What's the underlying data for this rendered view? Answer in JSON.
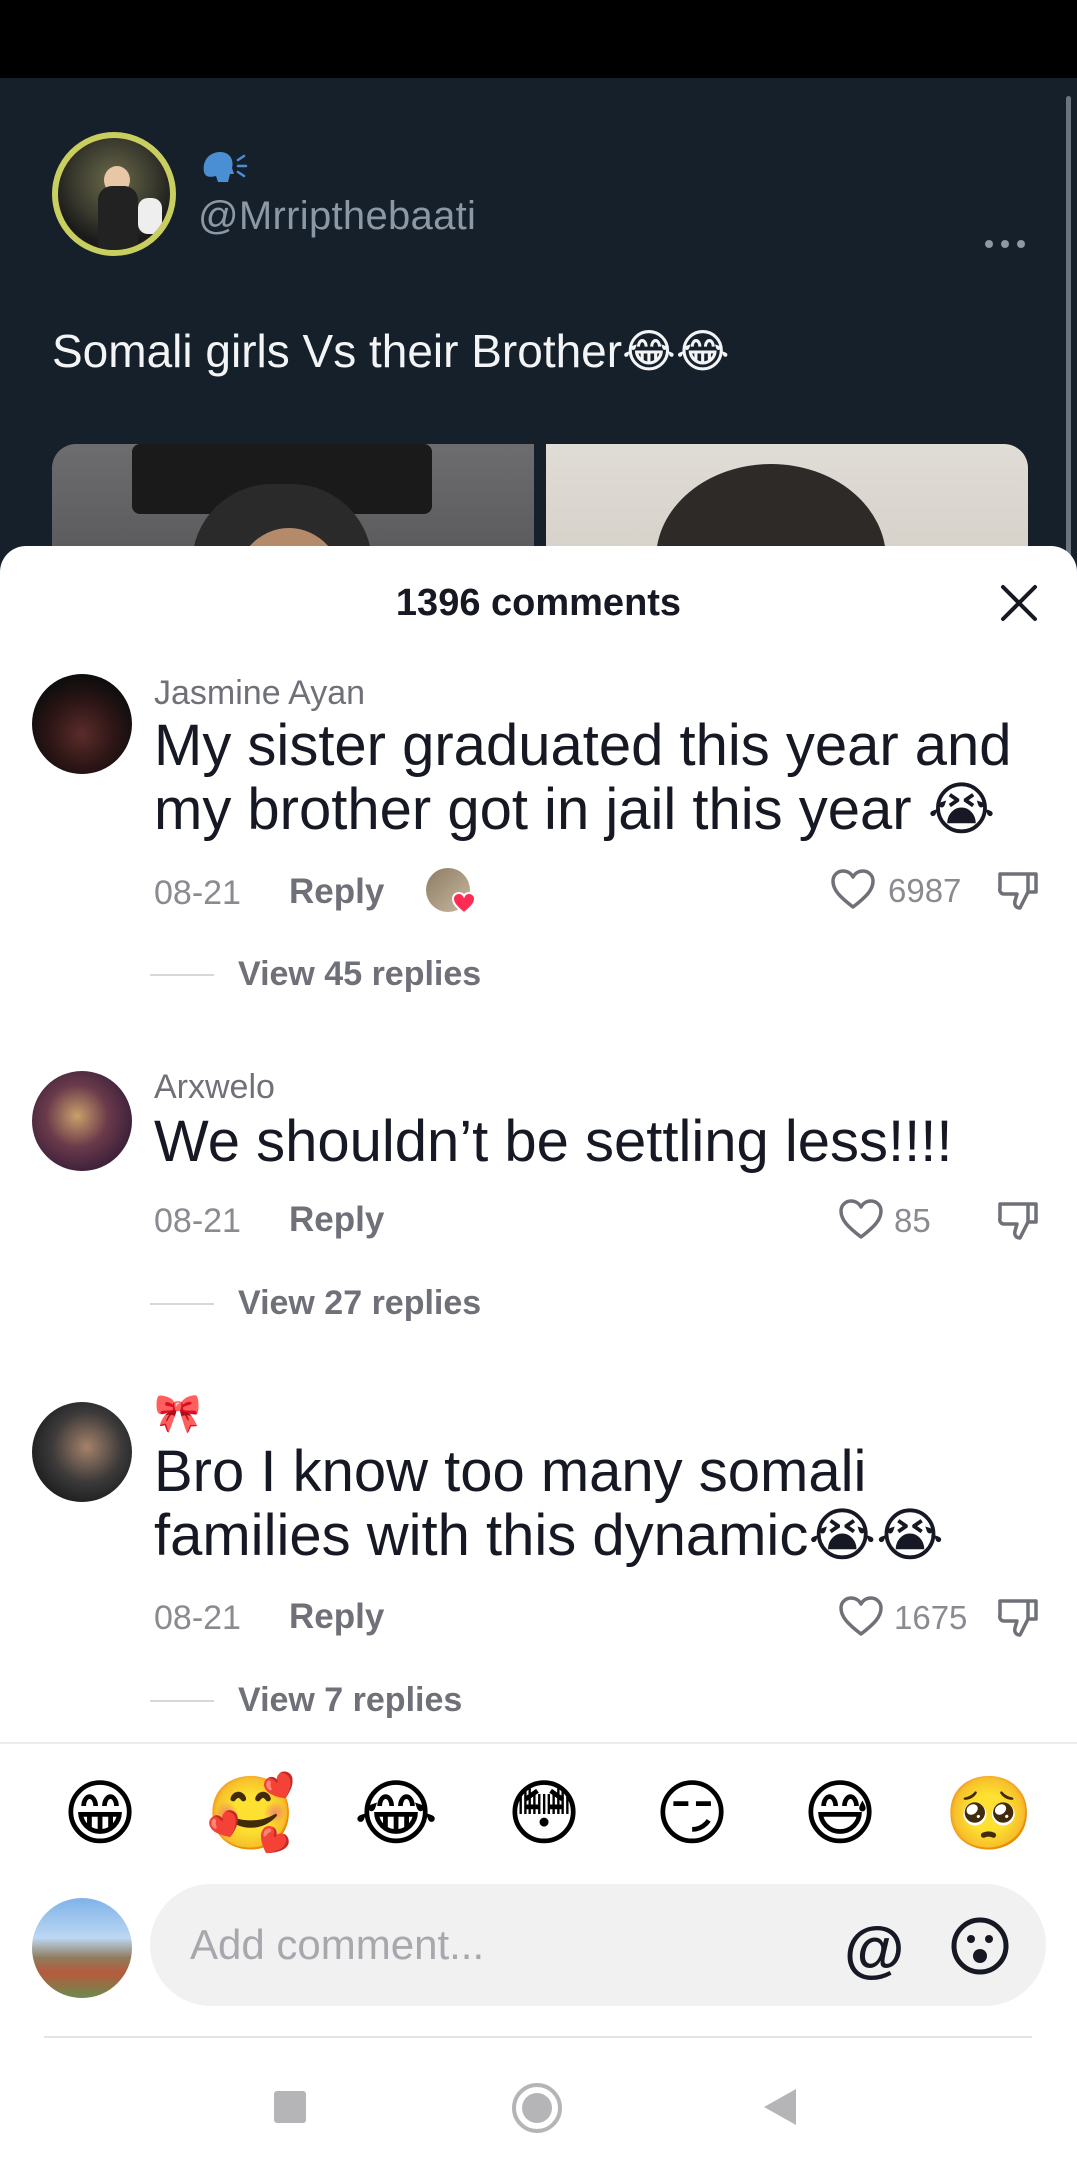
{
  "post": {
    "handle": "@Mrripthebaati",
    "text": "Somali girls Vs their Brother😂😂"
  },
  "sheet": {
    "title": "1396 comments"
  },
  "comments": [
    {
      "author": "Jasmine Ayan",
      "text": "My sister graduated this year and my brother got in jail this year 😭",
      "date": "08-21",
      "reply_label": "Reply",
      "likes": "6987",
      "view_replies": "View 45 replies"
    },
    {
      "author": "Arxwelo",
      "text": "We shouldn’t be settling less!!!!",
      "date": "08-21",
      "reply_label": "Reply",
      "likes": "85",
      "view_replies": "View 27 replies"
    },
    {
      "author": "🎀",
      "text": "Bro I know too many somali families with this dynamic😭😭",
      "date": "08-21",
      "reply_label": "Reply",
      "likes": "1675",
      "view_replies": "View 7 replies"
    }
  ],
  "emoji_bar": [
    "😁",
    "🥰",
    "😂",
    "😳",
    "😏",
    "😅",
    "🥺"
  ],
  "composer": {
    "placeholder": "Add comment...",
    "at_label": "@"
  },
  "icons": {
    "close": "close-icon",
    "like": "heart-outline-icon",
    "dislike": "thumbs-down-icon",
    "more": "more-dots-icon",
    "emoji_picker": "smiley-icon"
  },
  "colors": {
    "post_background": "#15202b",
    "sheet_background": "#ffffff",
    "text_primary": "#161823",
    "text_secondary": "#8a8b91"
  }
}
